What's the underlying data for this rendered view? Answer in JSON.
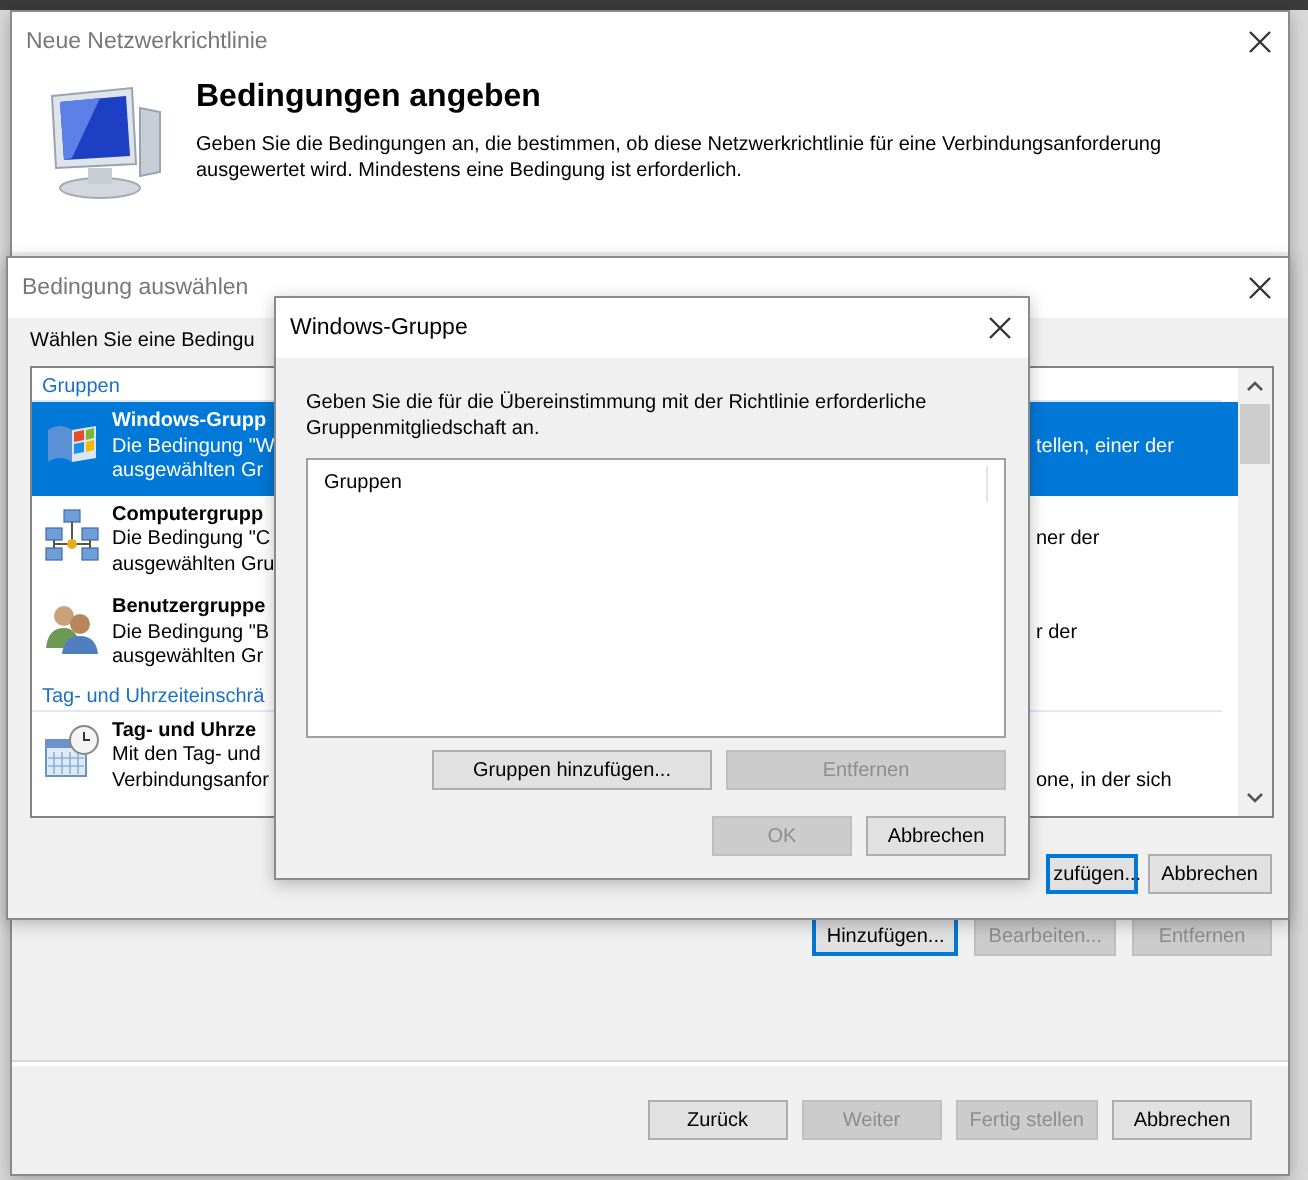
{
  "wizard": {
    "title": "Neue Netzwerkrichtlinie",
    "heading": "Bedingungen angeben",
    "description": "Geben Sie die Bedingungen an, die bestimmen, ob diese Netzwerkrichtlinie für eine Verbindungsanforderung ausgewertet wird. Mindestens eine Bedingung ist erforderlich.",
    "condition_buttons": [
      {
        "label": "Hinzufügen...",
        "disabled": false,
        "focused": true
      },
      {
        "label": "Bearbeiten...",
        "disabled": true,
        "focused": false
      },
      {
        "label": "Entfernen",
        "disabled": true,
        "focused": false
      }
    ],
    "nav_buttons": [
      {
        "label": "Zurück",
        "disabled": false,
        "focused": false
      },
      {
        "label": "Weiter",
        "disabled": true,
        "focused": false
      },
      {
        "label": "Fertig stellen",
        "disabled": true,
        "focused": false
      },
      {
        "label": "Abbrechen",
        "disabled": false,
        "focused": false
      }
    ]
  },
  "condition_dialog": {
    "title": "Bedingung auswählen",
    "prompt": "Wählen Sie eine Bedingu",
    "list": [
      {
        "kind": "category",
        "label": "Gruppen"
      },
      {
        "kind": "item",
        "selected": true,
        "rows": [
          {
            "left": "Windows-Grupp"
          },
          {
            "left": "Die Bedingung \"W",
            "right": "tellen, einer der"
          },
          {
            "left": "ausgewählten Gr"
          }
        ]
      },
      {
        "kind": "item",
        "selected": false,
        "rows": [
          {
            "left": "Computergrupp"
          },
          {
            "left": "Die Bedingung \"C",
            "right": "ner der"
          },
          {
            "left": "ausgewählten Gru"
          }
        ]
      },
      {
        "kind": "item",
        "selected": false,
        "rows": [
          {
            "left": "Benutzergruppe"
          },
          {
            "left": "Die Bedingung \"B",
            "right": "r der"
          },
          {
            "left": "ausgewählten Gr"
          }
        ]
      },
      {
        "kind": "category",
        "label": "Tag- und Uhrzeiteinschrä"
      },
      {
        "kind": "item",
        "selected": false,
        "rows": [
          {
            "left": "Tag- und Uhrze"
          },
          {
            "left": "Mit den Tag- und"
          },
          {
            "left": "Verbindungsanfor",
            "right": "one, in der sich"
          }
        ]
      }
    ],
    "buttons": [
      {
        "label": "zufügen...",
        "disabled": false,
        "focused": true
      },
      {
        "label": "Abbrechen",
        "disabled": false,
        "focused": false
      }
    ]
  },
  "group_dialog": {
    "title": "Windows-Gruppe",
    "description": "Geben Sie die für die Übereinstimmung mit der Richtlinie erforderliche Gruppenmitgliedschaft an.",
    "column": "Gruppen",
    "list_buttons": [
      {
        "label": "Gruppen hinzufügen...",
        "disabled": false,
        "focused": false
      },
      {
        "label": "Entfernen",
        "disabled": true,
        "focused": false
      }
    ],
    "buttons": [
      {
        "label": "OK",
        "disabled": true,
        "focused": false
      },
      {
        "label": "Abbrechen",
        "disabled": false,
        "focused": false
      }
    ]
  }
}
